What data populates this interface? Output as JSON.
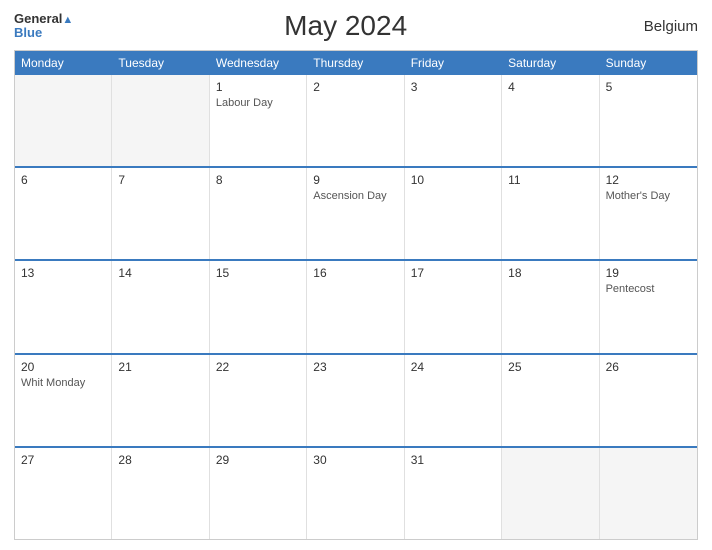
{
  "header": {
    "logo_line1": "General",
    "logo_line2": "Blue",
    "title": "May 2024",
    "country": "Belgium"
  },
  "days_header": [
    "Monday",
    "Tuesday",
    "Wednesday",
    "Thursday",
    "Friday",
    "Saturday",
    "Sunday"
  ],
  "weeks": [
    [
      {
        "num": "",
        "holiday": "",
        "empty": true
      },
      {
        "num": "",
        "holiday": "",
        "empty": true
      },
      {
        "num": "1",
        "holiday": "Labour Day",
        "empty": false
      },
      {
        "num": "2",
        "holiday": "",
        "empty": false
      },
      {
        "num": "3",
        "holiday": "",
        "empty": false
      },
      {
        "num": "4",
        "holiday": "",
        "empty": false
      },
      {
        "num": "5",
        "holiday": "",
        "empty": false
      }
    ],
    [
      {
        "num": "6",
        "holiday": "",
        "empty": false
      },
      {
        "num": "7",
        "holiday": "",
        "empty": false
      },
      {
        "num": "8",
        "holiday": "",
        "empty": false
      },
      {
        "num": "9",
        "holiday": "Ascension Day",
        "empty": false
      },
      {
        "num": "10",
        "holiday": "",
        "empty": false
      },
      {
        "num": "11",
        "holiday": "",
        "empty": false
      },
      {
        "num": "12",
        "holiday": "Mother's Day",
        "empty": false
      }
    ],
    [
      {
        "num": "13",
        "holiday": "",
        "empty": false
      },
      {
        "num": "14",
        "holiday": "",
        "empty": false
      },
      {
        "num": "15",
        "holiday": "",
        "empty": false
      },
      {
        "num": "16",
        "holiday": "",
        "empty": false
      },
      {
        "num": "17",
        "holiday": "",
        "empty": false
      },
      {
        "num": "18",
        "holiday": "",
        "empty": false
      },
      {
        "num": "19",
        "holiday": "Pentecost",
        "empty": false
      }
    ],
    [
      {
        "num": "20",
        "holiday": "Whit Monday",
        "empty": false
      },
      {
        "num": "21",
        "holiday": "",
        "empty": false
      },
      {
        "num": "22",
        "holiday": "",
        "empty": false
      },
      {
        "num": "23",
        "holiday": "",
        "empty": false
      },
      {
        "num": "24",
        "holiday": "",
        "empty": false
      },
      {
        "num": "25",
        "holiday": "",
        "empty": false
      },
      {
        "num": "26",
        "holiday": "",
        "empty": false
      }
    ],
    [
      {
        "num": "27",
        "holiday": "",
        "empty": false
      },
      {
        "num": "28",
        "holiday": "",
        "empty": false
      },
      {
        "num": "29",
        "holiday": "",
        "empty": false
      },
      {
        "num": "30",
        "holiday": "",
        "empty": false
      },
      {
        "num": "31",
        "holiday": "",
        "empty": false
      },
      {
        "num": "",
        "holiday": "",
        "empty": true
      },
      {
        "num": "",
        "holiday": "",
        "empty": true
      }
    ]
  ]
}
